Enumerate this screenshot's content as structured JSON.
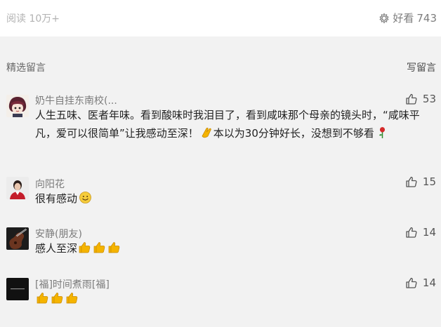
{
  "article": {
    "reads": "阅读 10万+",
    "good_label": "好看",
    "good_count": "743"
  },
  "section": {
    "title": "精选留言",
    "write_label": "写留言"
  },
  "comments": [
    {
      "nickname": "奶牛自挂东南校(...",
      "likes": "53",
      "text_part1": "人生五味、医者年味。看到酸味时我泪目了，看到咸味那个母亲的镜头时，“咸味平凡，爱可以很简单”让我感动至深！",
      "text_part2": "本以为30分钟好长，没想到不够看",
      "emojis": [
        "clapping-hands-emoji",
        "rose-emoji"
      ]
    },
    {
      "nickname": "向阳花",
      "likes": "15",
      "text_part1": "很有感动",
      "emojis": [
        "smile-emoji"
      ]
    },
    {
      "nickname": "安静(朋友)",
      "likes": "14",
      "text_part1": "感人至深",
      "emojis": [
        "thumbs-up-emoji",
        "thumbs-up-emoji",
        "thumbs-up-emoji"
      ]
    },
    {
      "nickname": "[福]时间煮雨[福]",
      "likes": "14",
      "text_part1": "",
      "emojis": [
        "thumbs-up-emoji",
        "thumbs-up-emoji",
        "thumbs-up-emoji"
      ]
    }
  ],
  "colors": {
    "background_band": "#f2f2f2",
    "emoji_yellow": "#f5b400",
    "rose_red": "#d42a2a"
  }
}
